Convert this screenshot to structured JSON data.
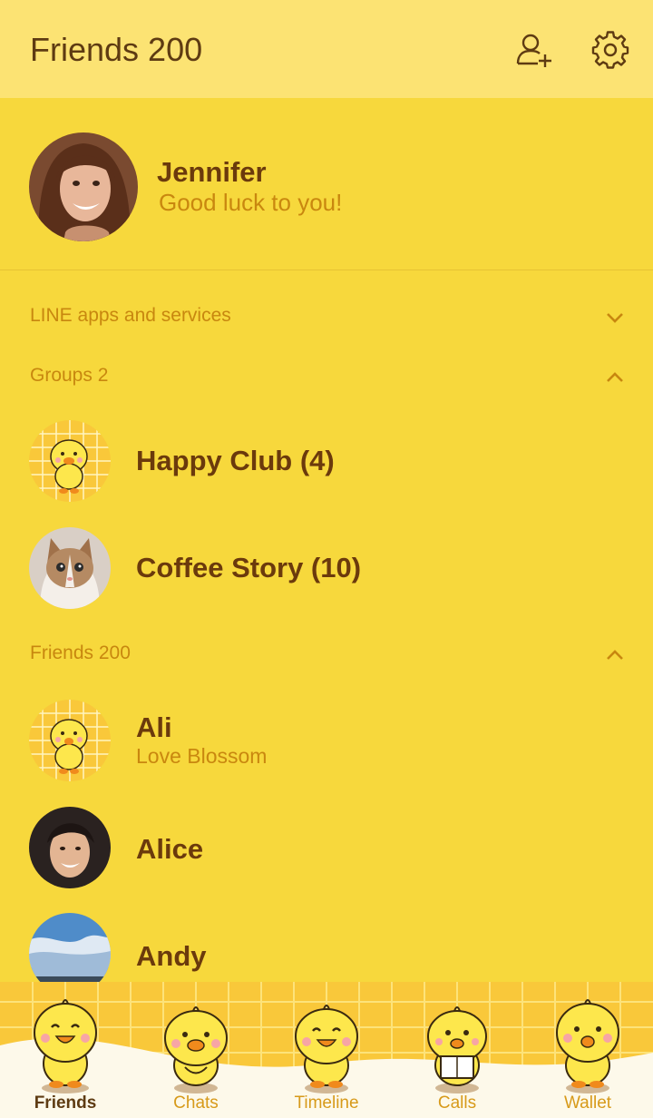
{
  "header": {
    "title": "Friends 200",
    "add_friend_icon": "add-friend-icon",
    "settings_icon": "gear-icon"
  },
  "profile": {
    "name": "Jennifer",
    "status": "Good luck to you!"
  },
  "sections": {
    "apps": {
      "label": "LINE apps and services",
      "state": "collapsed"
    },
    "groups": {
      "label": "Groups 2",
      "state": "expanded"
    },
    "friends": {
      "label": "Friends 200",
      "state": "expanded"
    }
  },
  "groups": [
    {
      "name": "Happy Club (4)"
    },
    {
      "name": "Coffee Story (10)"
    }
  ],
  "friends": [
    {
      "name": "Ali",
      "status": "Love Blossom"
    },
    {
      "name": "Alice",
      "status": ""
    },
    {
      "name": "Andy",
      "status": ""
    }
  ],
  "tabs": [
    {
      "label": "Friends",
      "active": true
    },
    {
      "label": "Chats",
      "active": false
    },
    {
      "label": "Timeline",
      "active": false
    },
    {
      "label": "Calls",
      "active": false
    },
    {
      "label": "Wallet",
      "active": false
    }
  ],
  "colors": {
    "background": "#f7d83c",
    "header": "#fce373",
    "text_dark": "#6b3a0c",
    "text_accent": "#c8870f"
  }
}
